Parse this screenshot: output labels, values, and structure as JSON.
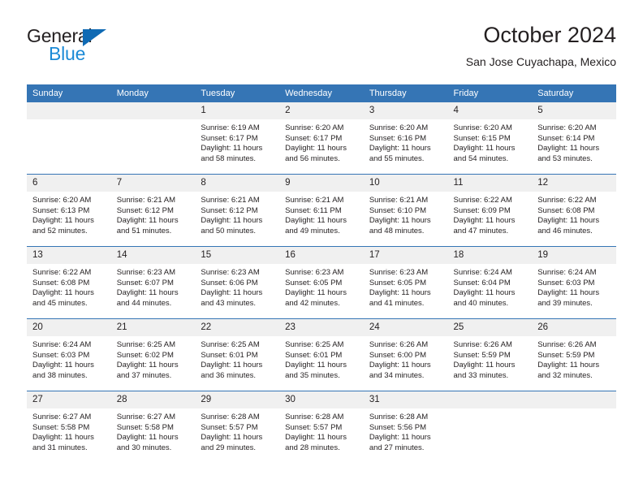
{
  "brand": {
    "name_part1": "General",
    "name_part2": "Blue",
    "triangle_icon": "blue-triangle-icon"
  },
  "header": {
    "title": "October 2024",
    "subtitle": "San Jose Cuyachapa, Mexico"
  },
  "colors": {
    "header_blue": "#3575b5",
    "logo_dark": "#231f20",
    "logo_blue": "#1b8ad6",
    "daynum_strip": "#f0f0f0"
  },
  "weekdays": [
    "Sunday",
    "Monday",
    "Tuesday",
    "Wednesday",
    "Thursday",
    "Friday",
    "Saturday"
  ],
  "labels": {
    "sunrise_prefix": "Sunrise:",
    "sunset_prefix": "Sunset:",
    "daylight_prefix": "Daylight:"
  },
  "weeks": [
    [
      {
        "day": "",
        "empty": true
      },
      {
        "day": "",
        "empty": true
      },
      {
        "day": "1",
        "sunrise": "Sunrise: 6:19 AM",
        "sunset": "Sunset: 6:17 PM",
        "daylight1": "Daylight: 11 hours",
        "daylight2": "and 58 minutes."
      },
      {
        "day": "2",
        "sunrise": "Sunrise: 6:20 AM",
        "sunset": "Sunset: 6:17 PM",
        "daylight1": "Daylight: 11 hours",
        "daylight2": "and 56 minutes."
      },
      {
        "day": "3",
        "sunrise": "Sunrise: 6:20 AM",
        "sunset": "Sunset: 6:16 PM",
        "daylight1": "Daylight: 11 hours",
        "daylight2": "and 55 minutes."
      },
      {
        "day": "4",
        "sunrise": "Sunrise: 6:20 AM",
        "sunset": "Sunset: 6:15 PM",
        "daylight1": "Daylight: 11 hours",
        "daylight2": "and 54 minutes."
      },
      {
        "day": "5",
        "sunrise": "Sunrise: 6:20 AM",
        "sunset": "Sunset: 6:14 PM",
        "daylight1": "Daylight: 11 hours",
        "daylight2": "and 53 minutes."
      }
    ],
    [
      {
        "day": "6",
        "sunrise": "Sunrise: 6:20 AM",
        "sunset": "Sunset: 6:13 PM",
        "daylight1": "Daylight: 11 hours",
        "daylight2": "and 52 minutes."
      },
      {
        "day": "7",
        "sunrise": "Sunrise: 6:21 AM",
        "sunset": "Sunset: 6:12 PM",
        "daylight1": "Daylight: 11 hours",
        "daylight2": "and 51 minutes."
      },
      {
        "day": "8",
        "sunrise": "Sunrise: 6:21 AM",
        "sunset": "Sunset: 6:12 PM",
        "daylight1": "Daylight: 11 hours",
        "daylight2": "and 50 minutes."
      },
      {
        "day": "9",
        "sunrise": "Sunrise: 6:21 AM",
        "sunset": "Sunset: 6:11 PM",
        "daylight1": "Daylight: 11 hours",
        "daylight2": "and 49 minutes."
      },
      {
        "day": "10",
        "sunrise": "Sunrise: 6:21 AM",
        "sunset": "Sunset: 6:10 PM",
        "daylight1": "Daylight: 11 hours",
        "daylight2": "and 48 minutes."
      },
      {
        "day": "11",
        "sunrise": "Sunrise: 6:22 AM",
        "sunset": "Sunset: 6:09 PM",
        "daylight1": "Daylight: 11 hours",
        "daylight2": "and 47 minutes."
      },
      {
        "day": "12",
        "sunrise": "Sunrise: 6:22 AM",
        "sunset": "Sunset: 6:08 PM",
        "daylight1": "Daylight: 11 hours",
        "daylight2": "and 46 minutes."
      }
    ],
    [
      {
        "day": "13",
        "sunrise": "Sunrise: 6:22 AM",
        "sunset": "Sunset: 6:08 PM",
        "daylight1": "Daylight: 11 hours",
        "daylight2": "and 45 minutes."
      },
      {
        "day": "14",
        "sunrise": "Sunrise: 6:23 AM",
        "sunset": "Sunset: 6:07 PM",
        "daylight1": "Daylight: 11 hours",
        "daylight2": "and 44 minutes."
      },
      {
        "day": "15",
        "sunrise": "Sunrise: 6:23 AM",
        "sunset": "Sunset: 6:06 PM",
        "daylight1": "Daylight: 11 hours",
        "daylight2": "and 43 minutes."
      },
      {
        "day": "16",
        "sunrise": "Sunrise: 6:23 AM",
        "sunset": "Sunset: 6:05 PM",
        "daylight1": "Daylight: 11 hours",
        "daylight2": "and 42 minutes."
      },
      {
        "day": "17",
        "sunrise": "Sunrise: 6:23 AM",
        "sunset": "Sunset: 6:05 PM",
        "daylight1": "Daylight: 11 hours",
        "daylight2": "and 41 minutes."
      },
      {
        "day": "18",
        "sunrise": "Sunrise: 6:24 AM",
        "sunset": "Sunset: 6:04 PM",
        "daylight1": "Daylight: 11 hours",
        "daylight2": "and 40 minutes."
      },
      {
        "day": "19",
        "sunrise": "Sunrise: 6:24 AM",
        "sunset": "Sunset: 6:03 PM",
        "daylight1": "Daylight: 11 hours",
        "daylight2": "and 39 minutes."
      }
    ],
    [
      {
        "day": "20",
        "sunrise": "Sunrise: 6:24 AM",
        "sunset": "Sunset: 6:03 PM",
        "daylight1": "Daylight: 11 hours",
        "daylight2": "and 38 minutes."
      },
      {
        "day": "21",
        "sunrise": "Sunrise: 6:25 AM",
        "sunset": "Sunset: 6:02 PM",
        "daylight1": "Daylight: 11 hours",
        "daylight2": "and 37 minutes."
      },
      {
        "day": "22",
        "sunrise": "Sunrise: 6:25 AM",
        "sunset": "Sunset: 6:01 PM",
        "daylight1": "Daylight: 11 hours",
        "daylight2": "and 36 minutes."
      },
      {
        "day": "23",
        "sunrise": "Sunrise: 6:25 AM",
        "sunset": "Sunset: 6:01 PM",
        "daylight1": "Daylight: 11 hours",
        "daylight2": "and 35 minutes."
      },
      {
        "day": "24",
        "sunrise": "Sunrise: 6:26 AM",
        "sunset": "Sunset: 6:00 PM",
        "daylight1": "Daylight: 11 hours",
        "daylight2": "and 34 minutes."
      },
      {
        "day": "25",
        "sunrise": "Sunrise: 6:26 AM",
        "sunset": "Sunset: 5:59 PM",
        "daylight1": "Daylight: 11 hours",
        "daylight2": "and 33 minutes."
      },
      {
        "day": "26",
        "sunrise": "Sunrise: 6:26 AM",
        "sunset": "Sunset: 5:59 PM",
        "daylight1": "Daylight: 11 hours",
        "daylight2": "and 32 minutes."
      }
    ],
    [
      {
        "day": "27",
        "sunrise": "Sunrise: 6:27 AM",
        "sunset": "Sunset: 5:58 PM",
        "daylight1": "Daylight: 11 hours",
        "daylight2": "and 31 minutes."
      },
      {
        "day": "28",
        "sunrise": "Sunrise: 6:27 AM",
        "sunset": "Sunset: 5:58 PM",
        "daylight1": "Daylight: 11 hours",
        "daylight2": "and 30 minutes."
      },
      {
        "day": "29",
        "sunrise": "Sunrise: 6:28 AM",
        "sunset": "Sunset: 5:57 PM",
        "daylight1": "Daylight: 11 hours",
        "daylight2": "and 29 minutes."
      },
      {
        "day": "30",
        "sunrise": "Sunrise: 6:28 AM",
        "sunset": "Sunset: 5:57 PM",
        "daylight1": "Daylight: 11 hours",
        "daylight2": "and 28 minutes."
      },
      {
        "day": "31",
        "sunrise": "Sunrise: 6:28 AM",
        "sunset": "Sunset: 5:56 PM",
        "daylight1": "Daylight: 11 hours",
        "daylight2": "and 27 minutes."
      },
      {
        "day": "",
        "empty": true
      },
      {
        "day": "",
        "empty": true
      }
    ]
  ]
}
